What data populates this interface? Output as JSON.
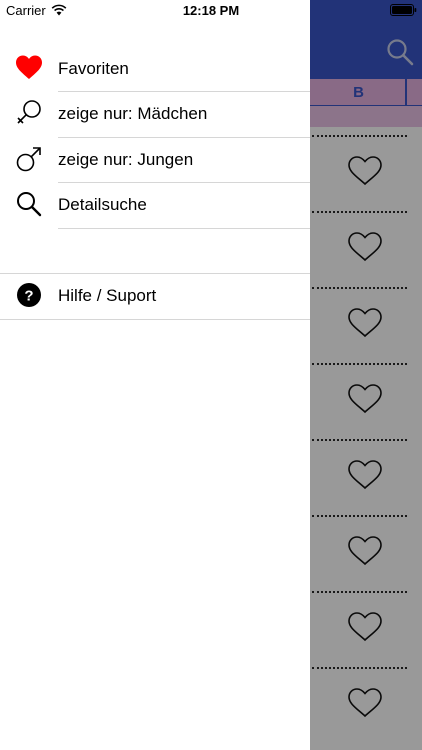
{
  "status_bar": {
    "carrier": "Carrier",
    "time": "12:18 PM",
    "wifi_icon": "wifi-icon",
    "battery_icon": "battery-icon"
  },
  "menu": {
    "items": [
      {
        "label": "Favoriten",
        "icon": "heart-filled-icon",
        "icon_color": "#ff0000"
      },
      {
        "label": "zeige nur: Mädchen",
        "icon": "female-symbol-icon"
      },
      {
        "label": "zeige nur: Jungen",
        "icon": "male-symbol-icon"
      },
      {
        "label": "Detailsuche",
        "icon": "search-icon"
      }
    ],
    "help": {
      "label": "Hilfe / Suport",
      "icon": "question-circle-icon"
    }
  },
  "background": {
    "navbar_color": "#3a56c9",
    "alphabet_header_letter": "B",
    "alphabet_bar_color": "#e4b1df",
    "row_icon": "heart-outline-icon"
  }
}
